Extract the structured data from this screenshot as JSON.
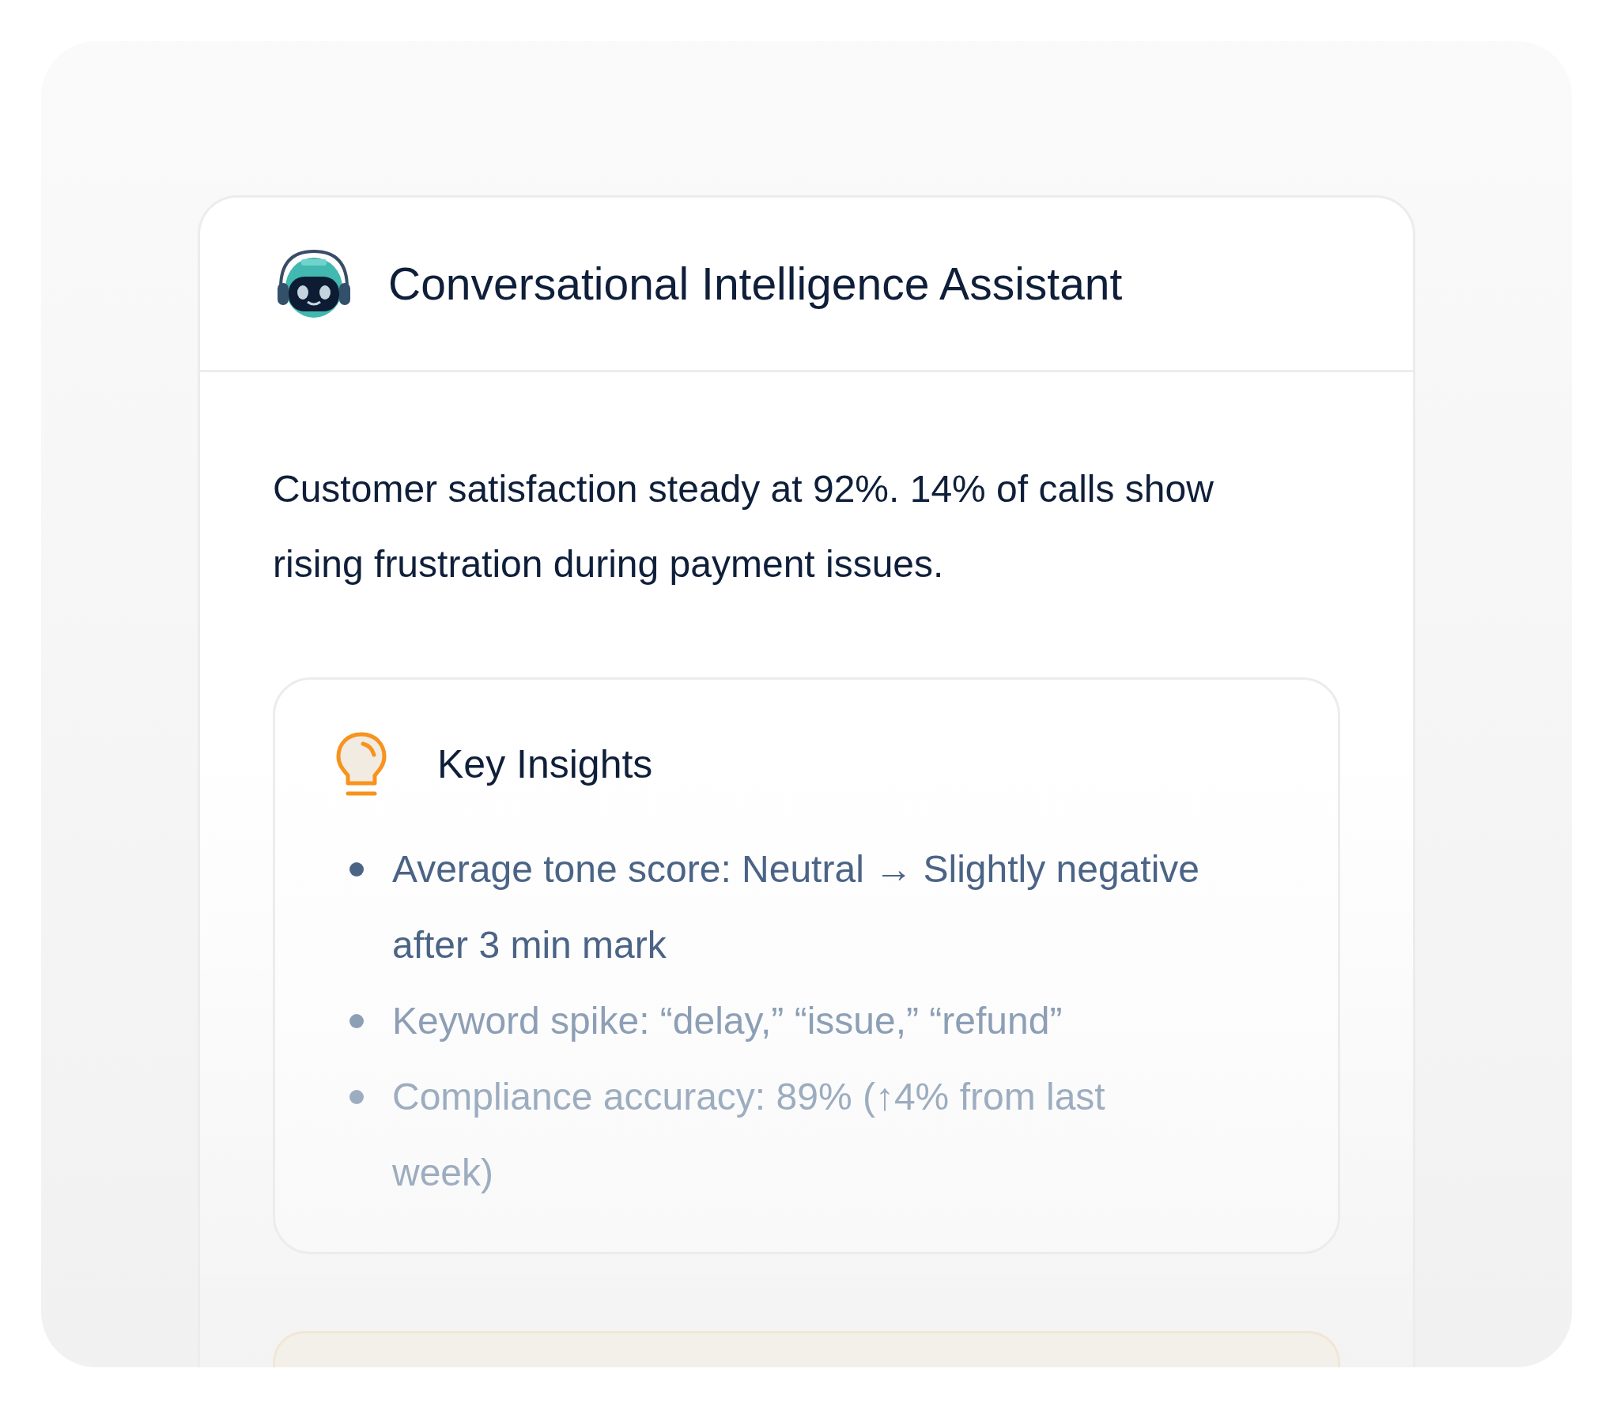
{
  "assistant": {
    "title": "Conversational Intelligence Assistant"
  },
  "summary": "Customer satisfaction steady at 92%. 14% of calls show rising frustration during payment issues.",
  "insights": {
    "title": "Key Insights",
    "items": [
      "Average tone score: Neutral → Slightly negative after 3 min mark",
      "Keyword spike: “delay,” “issue,” “refund”",
      "Compliance accuracy: 89% (↑4% from last week)"
    ]
  }
}
